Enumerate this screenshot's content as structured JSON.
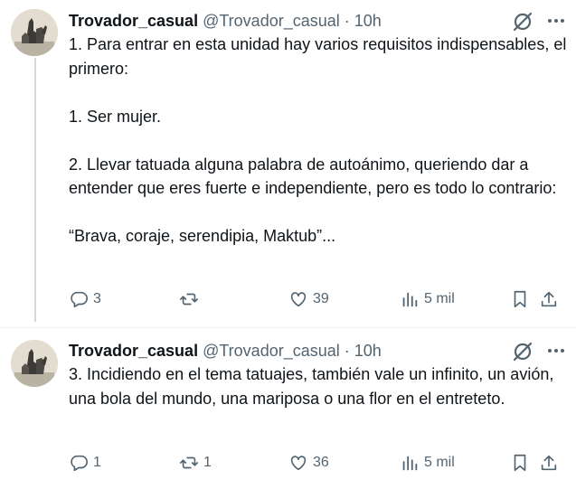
{
  "tweets": [
    {
      "author": {
        "name": "Trovador_casual",
        "handle": "@Trovador_casual",
        "time": "10h"
      },
      "paragraphs": [
        "1. Para entrar en esta unidad hay varios requisitos indispensables, el primero:",
        "1. Ser mujer.",
        "2. Llevar tatuada alguna palabra de autoánimo, queriendo dar a entender que eres fuerte e independiente, pero es todo lo contrario:",
        "“Brava, coraje, serendipia, Maktub”..."
      ],
      "stats": {
        "replies": "3",
        "reposts": "",
        "likes": "39",
        "views": "5 mil"
      }
    },
    {
      "author": {
        "name": "Trovador_casual",
        "handle": "@Trovador_casual",
        "time": "10h"
      },
      "paragraphs": [
        "3. Incidiendo en el tema tatuajes, también vale un infinito, un avión, una bola del mundo, una mariposa o una flor en el entreteto."
      ],
      "stats": {
        "replies": "1",
        "reposts": "1",
        "likes": "36",
        "views": "5 mil"
      }
    }
  ],
  "separator": "·",
  "icons": {
    "reply": "reply-icon",
    "repost": "repost-icon",
    "like": "heart-icon",
    "views": "views-icon",
    "bookmark": "bookmark-icon",
    "share": "share-icon",
    "grok": "grok-icon",
    "more": "more-icon"
  },
  "colors": {
    "text": "#0f1419",
    "secondary": "#536471",
    "thread_line": "#cfd9de"
  }
}
